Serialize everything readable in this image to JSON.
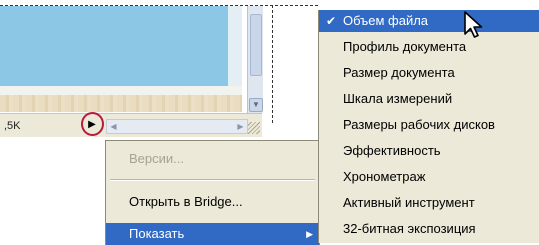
{
  "document": {
    "file_size_fragment": ",5K",
    "status_arrow": "▶",
    "scroll_left_arrow": "◀",
    "scroll_right_arrow": "▶",
    "scroll_down_arrow": "▼"
  },
  "context_menu": {
    "items": [
      {
        "label": "Версии...",
        "state": "disabled"
      },
      {
        "label": "Открыть в Bridge...",
        "state": "normal"
      },
      {
        "label": "Показать",
        "state": "highlighted",
        "submenu_arrow": "▶"
      }
    ]
  },
  "submenu": {
    "check_mark": "✔",
    "items": [
      {
        "label": "Объем файла",
        "checked": true,
        "highlighted": true
      },
      {
        "label": "Профиль документа",
        "checked": false
      },
      {
        "label": "Размер документа",
        "checked": false
      },
      {
        "label": "Шкала измерений",
        "checked": false
      },
      {
        "label": "Размеры рабочих дисков",
        "checked": false
      },
      {
        "label": "Эффективность",
        "checked": false
      },
      {
        "label": "Хронометраж",
        "checked": false
      },
      {
        "label": "Активный инструмент",
        "checked": false
      },
      {
        "label": "32-битная экспозиция",
        "checked": false
      }
    ]
  },
  "colors": {
    "menu_highlight": "#316ac5",
    "menu_background": "#ece9d8",
    "callout_circle": "#b51a3a",
    "canvas_sky": "#8dc7e6"
  },
  "icons": {
    "cursor": "arrow-pointer-icon"
  }
}
